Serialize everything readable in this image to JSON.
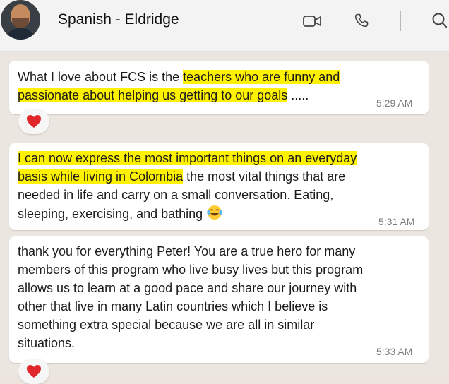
{
  "header": {
    "title": "Spanish - Eldridge"
  },
  "messages": [
    {
      "parts": [
        "What I love about FCS is the ",
        "teachers who are funny and",
        "passionate about helping us getting to our goals",
        " ....."
      ],
      "time": "5:29 AM",
      "reaction": "heart"
    },
    {
      "parts": [
        "I can now express the most important things on an everyday",
        "basis while living in Colombia",
        " the most vital things that are",
        "needed in life and carry on a small conversation. Eating,",
        "sleeping, exercising, and bathing"
      ],
      "emoji": "tears-of-joy",
      "time": "5:31 AM"
    },
    {
      "lines": [
        "thank you for everything Peter! You are a true hero for many",
        "members of this program who live busy lives but this program",
        "allows us to learn at a good pace and share our journey with",
        "other that live in many Latin countries which I believe is",
        "something extra special because we are all in similar",
        "situations."
      ],
      "time": "5:33 AM",
      "reaction": "heart"
    }
  ],
  "colors": {
    "highlight": "#fff200",
    "heart": "#e0262a",
    "chat_background": "#ebe6df"
  },
  "icons": [
    "video-camera-icon",
    "phone-icon",
    "search-icon",
    "heart-icon",
    "tears-of-joy-emoji"
  ]
}
